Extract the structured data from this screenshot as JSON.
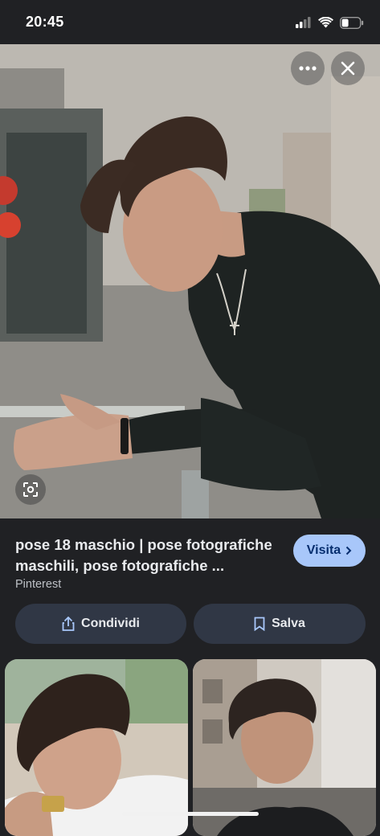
{
  "status_bar": {
    "time": "20:45",
    "icons": [
      "cellular-signal-icon",
      "wifi-icon",
      "battery-icon"
    ]
  },
  "viewer": {
    "more_icon": "more-horiz-icon",
    "close_icon": "close-icon",
    "lens_icon": "lens-search-icon"
  },
  "result": {
    "title": "pose 18 maschio | pose fotografiche maschili, pose fotografiche ...",
    "source": "Pinterest",
    "visit_label": "Visita"
  },
  "actions": {
    "share_label": "Condividi",
    "save_label": "Salva"
  },
  "colors": {
    "background": "#202124",
    "visit_button": "#a8c7fa",
    "action_button": "#303745"
  }
}
